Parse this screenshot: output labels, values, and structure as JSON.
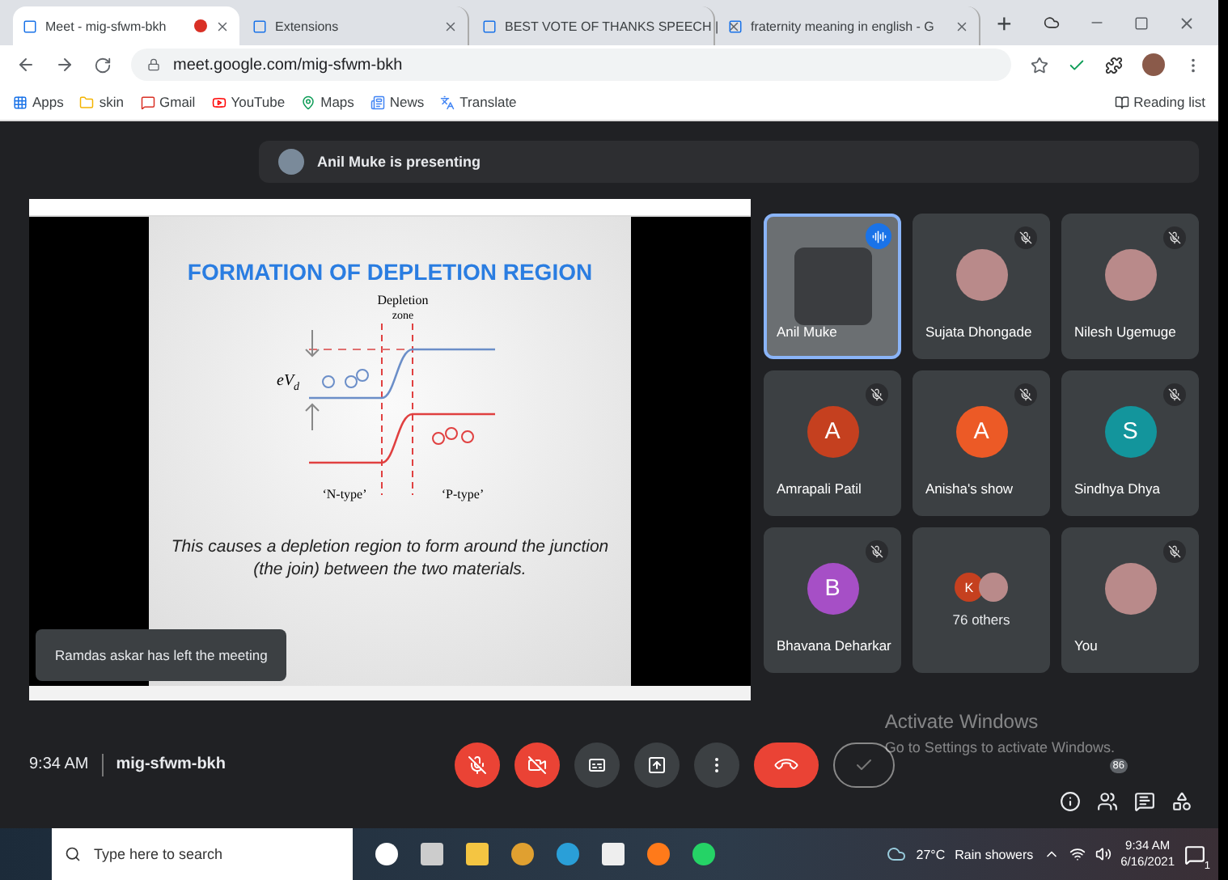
{
  "browser": {
    "tabs": [
      {
        "title": "Meet - mig-sfwm-bkh",
        "selected": true,
        "recording": true
      },
      {
        "title": "Extensions",
        "selected": false,
        "recording": false
      },
      {
        "title": "BEST VOTE OF THANKS SPEECH |",
        "selected": false,
        "recording": false
      },
      {
        "title": "fraternity meaning in english - G",
        "selected": false,
        "recording": false
      }
    ],
    "new_tab": "+",
    "url": "meet.google.com/mig-sfwm-bkh",
    "bookmarks": [
      {
        "label": "Apps",
        "kind": "apps"
      },
      {
        "label": "skin",
        "kind": "folder"
      },
      {
        "label": "Gmail",
        "kind": "gmail"
      },
      {
        "label": "YouTube",
        "kind": "youtube"
      },
      {
        "label": "Maps",
        "kind": "maps"
      },
      {
        "label": "News",
        "kind": "news"
      },
      {
        "label": "Translate",
        "kind": "translate"
      }
    ],
    "reading_list": "Reading list"
  },
  "meet": {
    "banner": "Anil Muke is presenting",
    "slide": {
      "title": "FORMATION OF DEPLETION REGION",
      "zone_label": [
        "Depletion",
        "zone"
      ],
      "potential": "eV",
      "potential_sub": "d",
      "n_label": "‘N-type’",
      "p_label": "‘P-type’",
      "caption": "This causes a depletion region to form around the junction (the join) between the two materials."
    },
    "toast": "Ramdas askar has left the meeting",
    "participants": [
      {
        "name": "Anil Muke",
        "kind": "video",
        "muted": false,
        "speaking": true
      },
      {
        "name": "Sujata Dhongade",
        "kind": "photo",
        "muted": true,
        "speaking": false
      },
      {
        "name": "Nilesh Ugemuge",
        "kind": "photo",
        "muted": true,
        "speaking": false
      },
      {
        "name": "Amrapali Patil",
        "kind": "initial",
        "initial": "A",
        "color": "#c5401f",
        "muted": true,
        "speaking": false
      },
      {
        "name": "Anisha's show",
        "kind": "initial",
        "initial": "A",
        "color": "#ec5a26",
        "muted": true,
        "speaking": false
      },
      {
        "name": "Sindhya Dhya",
        "kind": "initial",
        "initial": "S",
        "color": "#13959c",
        "muted": true,
        "speaking": false
      },
      {
        "name": "Bhavana Deharkar",
        "kind": "initial",
        "initial": "B",
        "color": "#a64fc6",
        "muted": true,
        "speaking": false
      },
      {
        "name": "76 others",
        "kind": "others",
        "initial": "K",
        "color": "#c5401f",
        "muted": false,
        "speaking": false
      },
      {
        "name": "You",
        "kind": "photo",
        "muted": true,
        "speaking": false
      }
    ],
    "time": "9:34 AM",
    "meeting_code": "mig-sfwm-bkh",
    "controls": [
      {
        "kind": "mic",
        "on": false
      },
      {
        "kind": "camera",
        "on": false
      },
      {
        "kind": "captions"
      },
      {
        "kind": "present"
      },
      {
        "kind": "more"
      },
      {
        "kind": "leave"
      },
      {
        "kind": "check"
      }
    ],
    "watermark": [
      "Activate Windows",
      "Go to Settings to activate Windows."
    ],
    "people_count": "86"
  },
  "taskbar": {
    "search_placeholder": "Type here to search",
    "temperature": "27°C",
    "weather": "Rain showers",
    "time": "9:34 AM",
    "date": "6/16/2021",
    "notifications": "1"
  }
}
